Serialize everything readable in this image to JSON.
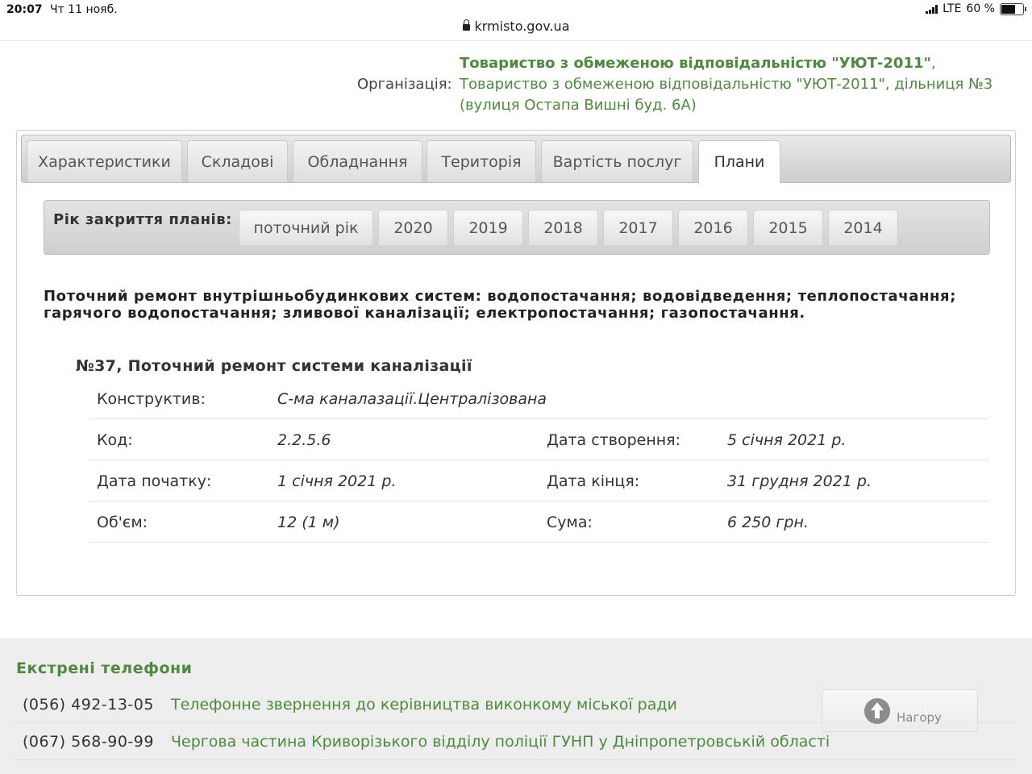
{
  "status_bar": {
    "time": "20:07",
    "date": "Чт 11 нояб.",
    "network": "LTE",
    "battery": "60 %",
    "url": "krmisto.gov.ua"
  },
  "organization": {
    "label": "Організація:",
    "name_bold": "Товариство з обмеженою відповідальністю \"УЮТ-2011\"",
    "name_rest": ", Товариство з обмеженою відповідальністю \"УЮТ-2011\", дільниця №3 (вулиця Остапа Вишні буд. 6А)"
  },
  "tabs": [
    {
      "label": "Характеристики"
    },
    {
      "label": "Складові"
    },
    {
      "label": "Обладнання"
    },
    {
      "label": "Територія"
    },
    {
      "label": "Вартість послуг"
    },
    {
      "label": "Плани"
    }
  ],
  "active_tab": "Плани",
  "years": {
    "label": "Рік закриття планів:",
    "buttons": [
      "поточний рік",
      "2020",
      "2019",
      "2018",
      "2017",
      "2016",
      "2015",
      "2014"
    ]
  },
  "plan_heading": "Поточний ремонт внутрішньобудинкових систем: водопостачання; водовідведення; теплопостачання; гарячого водопостачання; зливової каналізації; електропостачання; газопостачання.",
  "plan_item": {
    "title": "№37, Поточний ремонт системи каналізації",
    "construct_label": "Конструктив:",
    "construct_value": "С-ма каналазації.Централізована",
    "code_label": "Код:",
    "code_value": "2.2.5.6",
    "created_label": "Дата створення:",
    "created_value": "5 січня 2021 р.",
    "start_label": "Дата початку:",
    "start_value": "1 січня 2021 р.",
    "end_label": "Дата кінця:",
    "end_value": "31 грудня 2021 р.",
    "volume_label": "Об'єм:",
    "volume_value": "12 (1 м)",
    "sum_label": "Сума:",
    "sum_value": "6 250 грн."
  },
  "footer": {
    "title": "Екстрені телефони",
    "phones": [
      {
        "number": "(056) 492-13-05",
        "desc": "Телефонне звернення до керівництва виконкому міської ради"
      },
      {
        "number": "(067) 568-90-99",
        "desc": "Чергова частина Криворізького відділу поліції ГУНП у Дніпропетровській області"
      }
    ],
    "to_top_label": "Нагору"
  },
  "colors": {
    "accent_green": "#4e8a3e",
    "footer_bg": "#eeeeee"
  }
}
